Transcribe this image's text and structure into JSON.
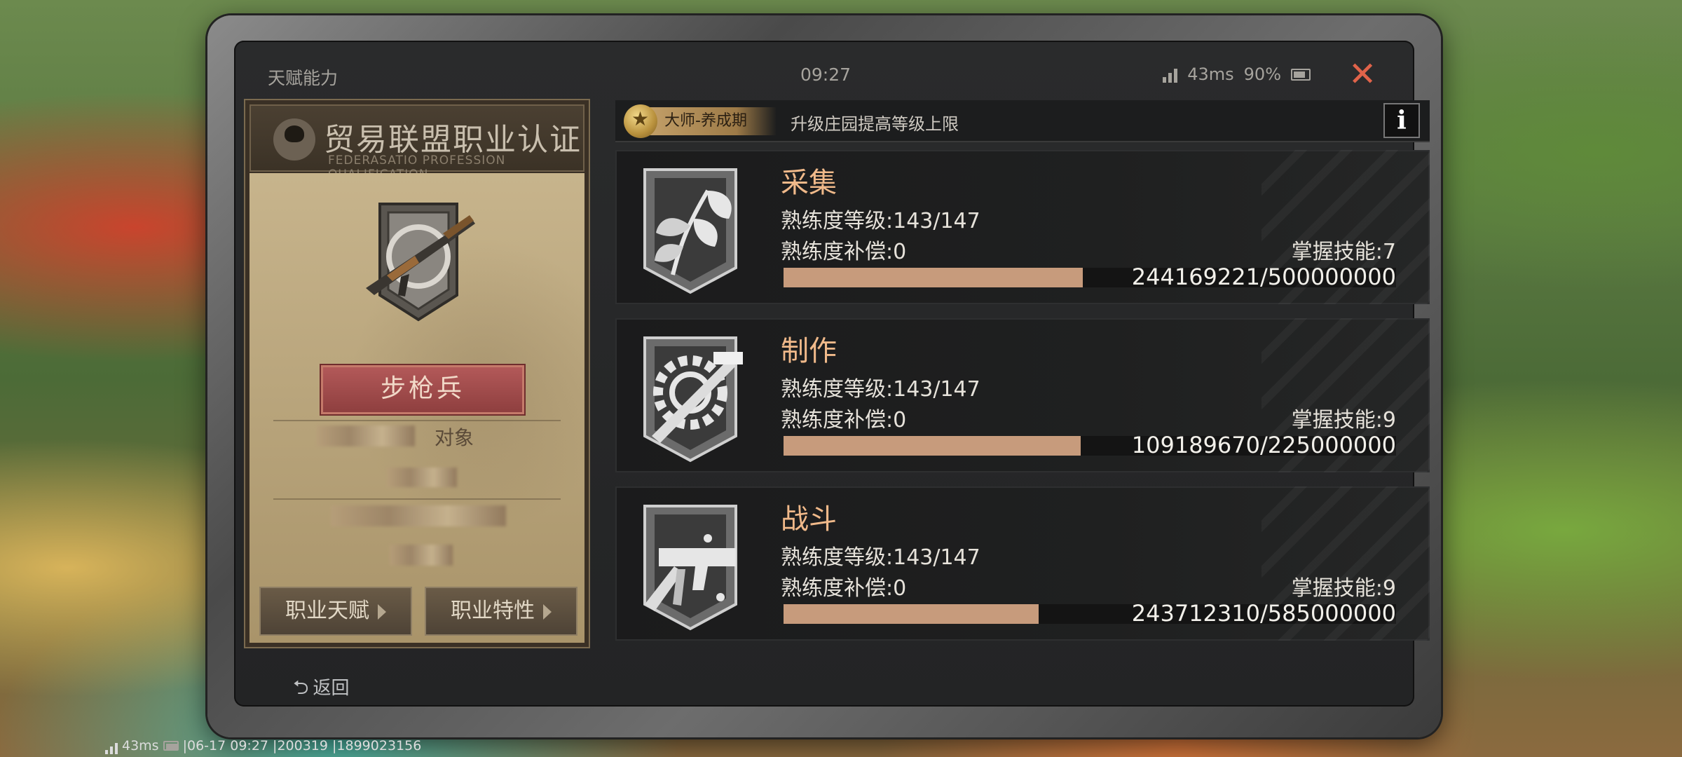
{
  "window": {
    "title": "天赋能力",
    "time": "09:27",
    "latency": "43ms",
    "battery_pct": "90%",
    "close_icon": "close-icon"
  },
  "certificate": {
    "title": "贸易联盟职业认证",
    "subtitle": "FEDERASATIO PROFESSION QUALIFICATION",
    "class_name": "步枪兵",
    "partial_label": "对象",
    "buttons": {
      "talent": "职业天赋",
      "trait": "职业特性"
    }
  },
  "rank": {
    "badge": "大师-养成期",
    "description": "升级庄园提高等级上限",
    "info_label": "i"
  },
  "skills": [
    {
      "name": "采集",
      "level": "熟练度等级:143/147",
      "compensation": "熟练度补偿:0",
      "mastery": "掌握技能:7",
      "progress_text": "244169221/500000000",
      "progress": 0.488,
      "icon": "leaf-icon"
    },
    {
      "name": "制作",
      "level": "熟练度等级:143/147",
      "compensation": "熟练度补偿:0",
      "mastery": "掌握技能:9",
      "progress_text": "109189670/225000000",
      "progress": 0.485,
      "icon": "gear-hammer-icon"
    },
    {
      "name": "战斗",
      "level": "熟练度等级:143/147",
      "compensation": "熟练度补偿:0",
      "mastery": "掌握技能:9",
      "progress_text": "243712310/585000000",
      "progress": 0.417,
      "icon": "smg-icon"
    }
  ],
  "footer": {
    "back_label": "返回",
    "debug_latency": "43ms",
    "debug_info": "|06-17 09:27 |200319 |1899023156"
  },
  "colors": {
    "accent": "#f0b98a",
    "progress": "#c79b7c",
    "close": "#e0634a",
    "class_plate": "#a84f4f"
  }
}
